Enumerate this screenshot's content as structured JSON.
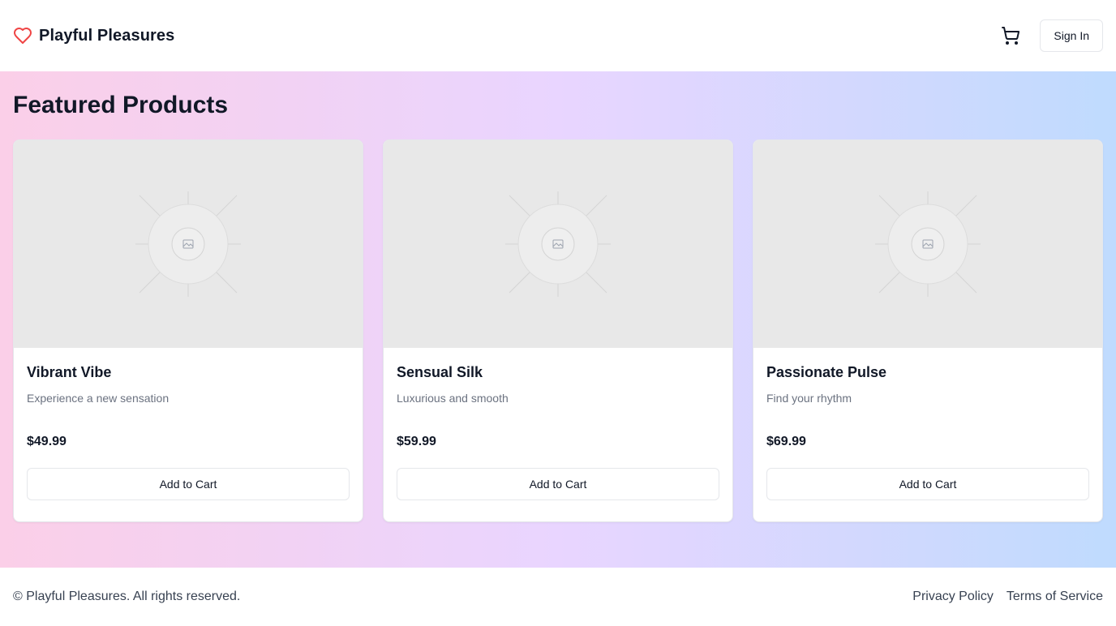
{
  "header": {
    "brand_name": "Playful Pleasures",
    "brand_icon": "heart-icon",
    "cart_icon": "shopping-cart-icon",
    "signin_label": "Sign In"
  },
  "main": {
    "title": "Featured Products",
    "products": [
      {
        "name": "Vibrant Vibe",
        "description": "Experience a new sensation",
        "price": "$49.99",
        "button_label": "Add to Cart",
        "image_icon": "image-placeholder-icon"
      },
      {
        "name": "Sensual Silk",
        "description": "Luxurious and smooth",
        "price": "$59.99",
        "button_label": "Add to Cart",
        "image_icon": "image-placeholder-icon"
      },
      {
        "name": "Passionate Pulse",
        "description": "Find your rhythm",
        "price": "$69.99",
        "button_label": "Add to Cart",
        "image_icon": "image-placeholder-icon"
      }
    ]
  },
  "footer": {
    "copyright": "© Playful Pleasures. All rights reserved.",
    "links": [
      "Privacy Policy",
      "Terms of Service"
    ]
  },
  "colors": {
    "gradient_start": "#fbcfe8",
    "gradient_mid": "#e9d5ff",
    "gradient_end": "#bfdbfe",
    "heart": "#ef4444",
    "text": "#111827",
    "muted": "#6b7280",
    "placeholder_bg": "#e8e8e8"
  }
}
